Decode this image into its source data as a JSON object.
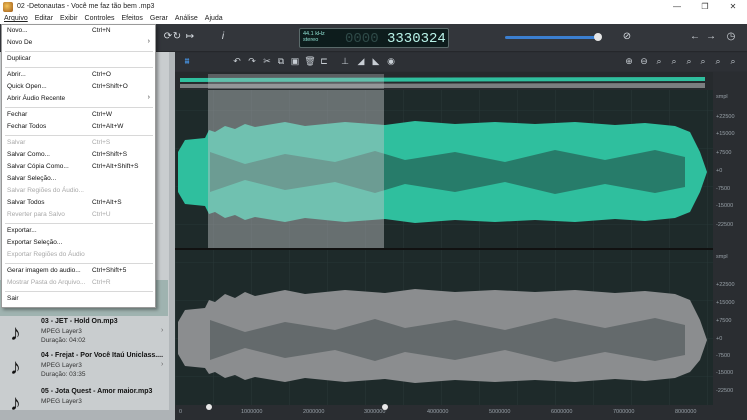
{
  "window": {
    "title": "02 -Detonautas - Você me faz tão bem .mp3",
    "controls": [
      "—",
      "❐",
      "✕"
    ]
  },
  "menubar": [
    "Arquivo",
    "Editar",
    "Exibir",
    "Controles",
    "Efeitos",
    "Gerar",
    "Análise",
    "Ajuda"
  ],
  "display": {
    "rate": "44.1 kHz",
    "channels": "stereo",
    "ghost_digits": "0000",
    "counter": "3330324"
  },
  "player": {
    "volume_fraction": 0.96
  },
  "file_menu": {
    "items": [
      {
        "label": "Novo...",
        "shortcut": "Ctrl+N"
      },
      {
        "label": "Novo De",
        "shortcut": "",
        "submenu": "›"
      },
      {
        "sep": true
      },
      {
        "label": "Duplicar",
        "shortcut": ""
      },
      {
        "sep": true
      },
      {
        "label": "Abrir...",
        "shortcut": "Ctrl+O"
      },
      {
        "label": "Quick Open...",
        "shortcut": "Ctrl+Shift+O"
      },
      {
        "label": "Abrir Áudio Recente",
        "shortcut": "",
        "submenu": "›"
      },
      {
        "sep": true
      },
      {
        "label": "Fechar",
        "shortcut": "Ctrl+W"
      },
      {
        "label": "Fechar Todos",
        "shortcut": "Ctrl+Alt+W"
      },
      {
        "sep": true
      },
      {
        "label": "Salvar",
        "shortcut": "Ctrl+S",
        "disabled": true
      },
      {
        "label": "Salvar Como...",
        "shortcut": "Ctrl+Shift+S"
      },
      {
        "label": "Salvar Cópia Como...",
        "shortcut": "Ctrl+Alt+Shift+S"
      },
      {
        "label": "Salvar Seleção...",
        "shortcut": ""
      },
      {
        "label": "Salvar Regiões do Áudio...",
        "shortcut": "",
        "disabled": true
      },
      {
        "label": "Salvar Todos",
        "shortcut": "Ctrl+Alt+S"
      },
      {
        "label": "Reverter para Salvo",
        "shortcut": "Ctrl+U",
        "disabled": true
      },
      {
        "sep": true
      },
      {
        "label": "Exportar...",
        "shortcut": ""
      },
      {
        "label": "Exportar Seleção...",
        "shortcut": ""
      },
      {
        "label": "Exportar Regiões do Áudio",
        "shortcut": "",
        "disabled": true
      },
      {
        "sep": true
      },
      {
        "label": "Gerar imagem do audio...",
        "shortcut": "Ctrl+Shift+5"
      },
      {
        "label": "Mostrar Pasta do Arquivo...",
        "shortcut": "Ctrl+R",
        "disabled": true
      },
      {
        "sep": true
      },
      {
        "label": "Sair",
        "shortcut": ""
      }
    ]
  },
  "files": [
    {
      "name": "03 - JET - Hold On.mp3",
      "format": "MPEG Layer3",
      "duration": "Duração: 04:02"
    },
    {
      "name": "04 - Frejat - Por Você Itaú Uniclass....",
      "format": "MPEG Layer3",
      "duration": "Duração: 03:35"
    },
    {
      "name": "05 - Jota Quest - Amor maior.mp3",
      "format": "MPEG Layer3",
      "duration": ""
    }
  ],
  "amplitude_scale": {
    "top": [
      "smpl",
      "+22500",
      "+15000",
      "+7500",
      "+0",
      "-7500",
      "-15000",
      "-22500"
    ],
    "bottom": [
      "smpl",
      "+22500",
      "+15000",
      "+7500",
      "+0",
      "-7500",
      "-15000",
      "-22500"
    ]
  },
  "timeline": [
    "0",
    "1000000",
    "2000000",
    "3000000",
    "4000000",
    "5000000",
    "6000000",
    "7000000",
    "8000000"
  ],
  "colors": {
    "active_wave": "#2fbf9e",
    "inactive_wave": "#8b8d8f",
    "selection": "#9ea3a6",
    "display_digits": "#b8f3e8"
  },
  "icons": {
    "toolbar": [
      "play-icon",
      "loop-icon",
      "skip-icon",
      "info-icon",
      "mute-icon",
      "back-icon",
      "forward-icon",
      "history-icon"
    ],
    "editor": [
      "waveform-view-icon",
      "undo-icon",
      "redo-icon",
      "cut-icon",
      "copy-icon",
      "paste-icon",
      "delete-icon",
      "trim-icon",
      "silence-icon",
      "fade-in-icon",
      "fade-out-icon",
      "normalize-icon",
      "zoom-in-icon",
      "zoom-out-icon",
      "zoom-selection-icon",
      "zoom-all-icon"
    ]
  }
}
